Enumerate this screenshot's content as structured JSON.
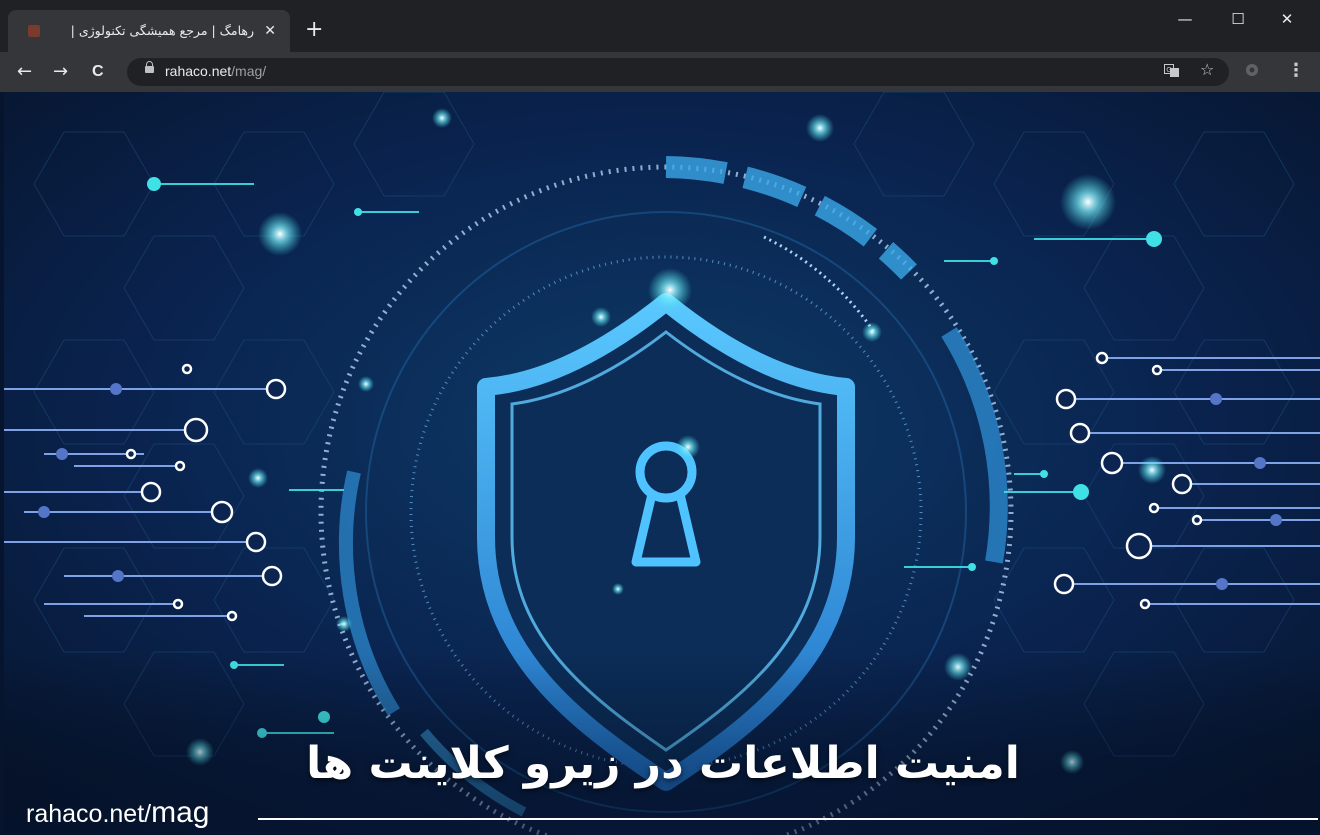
{
  "browser": {
    "tab": {
      "title": "رهامگ | مرجع همیشگی تکنولوژی |",
      "close_glyph": "✕"
    },
    "new_tab_glyph": "+",
    "window_controls": {
      "minimize": "—",
      "maximize": "☐",
      "close": "✕"
    },
    "nav": {
      "back": "←",
      "forward": "→",
      "reload": "C"
    },
    "url": {
      "domain": "rahaco.net",
      "path": "/mag/"
    },
    "toolbar_icons": [
      "translate-icon",
      "star-icon",
      "extension-icon",
      "menu-icon"
    ]
  },
  "page": {
    "headline": "امنیت اطلاعات در زیرو کلاینت ها",
    "watermark": {
      "prefix": "rahaco.net/",
      "suffix": "mag"
    }
  },
  "colors": {
    "accent_cyan": "#3fe0e6",
    "shield_blue": "#3a9ee6",
    "background_navy": "#06142e"
  }
}
